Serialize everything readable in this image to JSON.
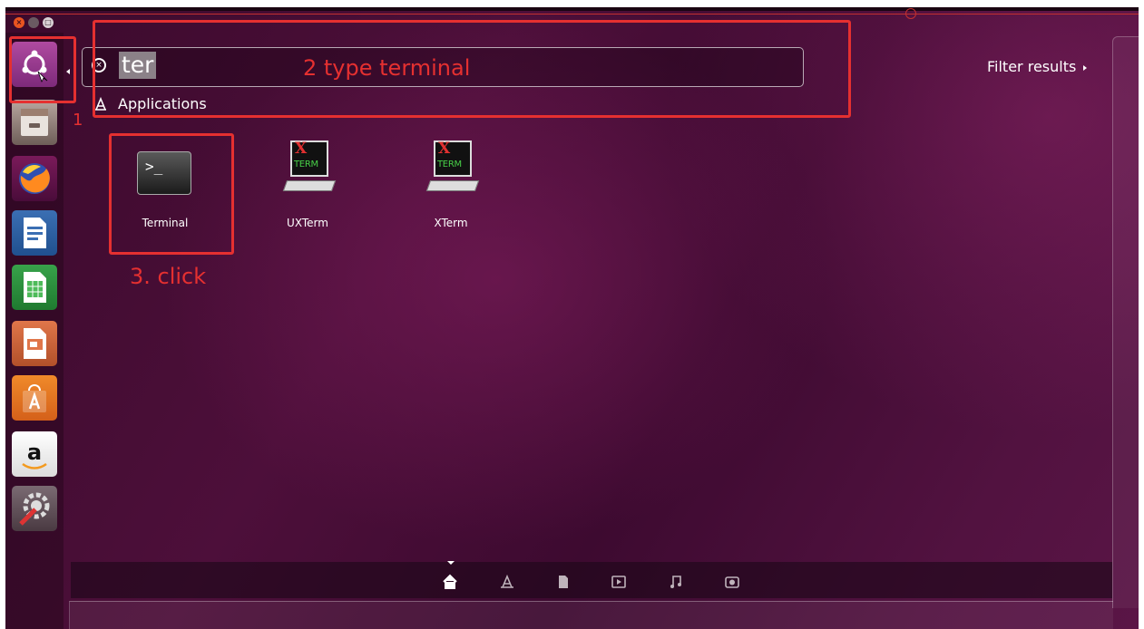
{
  "search": {
    "query": "ter"
  },
  "filter": {
    "label": "Filter results"
  },
  "section": {
    "applications_label": "Applications"
  },
  "results": [
    {
      "label": "Terminal",
      "icon": "terminal-icon"
    },
    {
      "label": "UXTerm",
      "icon": "xterm-icon",
      "glyph_x": "X",
      "glyph_term": "TERM"
    },
    {
      "label": "XTerm",
      "icon": "xterm-icon",
      "glyph_x": "X",
      "glyph_term": "TERM"
    }
  ],
  "terminal_glyph": "&gt;_",
  "annotations": {
    "step1": "1",
    "step2": "2 type terminal",
    "step3": "3. click",
    "color": "#e53030"
  },
  "launcher": {
    "items": [
      "dash-home",
      "files",
      "firefox",
      "libreoffice-writer",
      "libreoffice-calc",
      "libreoffice-impress",
      "ubuntu-software",
      "amazon",
      "system-settings"
    ]
  },
  "lens_bar": {
    "items": [
      "home",
      "applications",
      "files",
      "video",
      "music",
      "photos"
    ],
    "active": "home"
  },
  "colors": {
    "accent": "#e95420",
    "background": "#4d0f3a"
  }
}
